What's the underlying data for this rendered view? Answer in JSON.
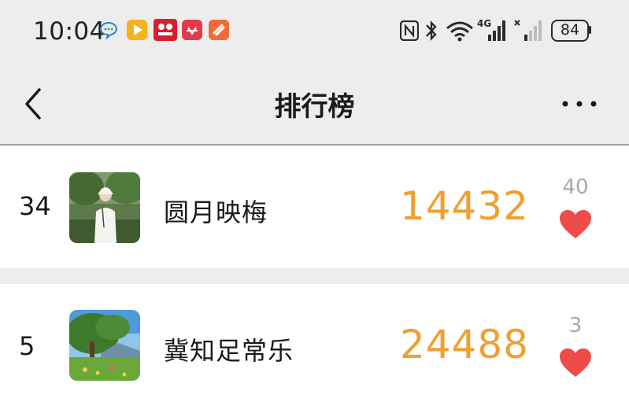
{
  "status_bar": {
    "time": "10:04",
    "network": "4G",
    "battery": "84",
    "notification_icons": [
      "chat-bubble-icon",
      "video-play-icon",
      "shopping-app-icon",
      "huawei-icon",
      "orange-app-icon"
    ]
  },
  "nav": {
    "title": "排行榜",
    "back_icon": "chevron-left-icon",
    "more_icon": "more-dots-icon"
  },
  "rows": [
    {
      "rank": "34",
      "name": "圆月映梅",
      "score": "14432",
      "likes": "40",
      "avatar": "elderly-person-photo"
    },
    {
      "rank": "5",
      "name": "冀知足常乐",
      "score": "24488",
      "likes": "3",
      "avatar": "landscape-tree-photo"
    }
  ],
  "colors": {
    "accent_score": "#f0a030",
    "heart": "#ee4b4b",
    "background": "#ededed",
    "card": "#ffffff"
  }
}
